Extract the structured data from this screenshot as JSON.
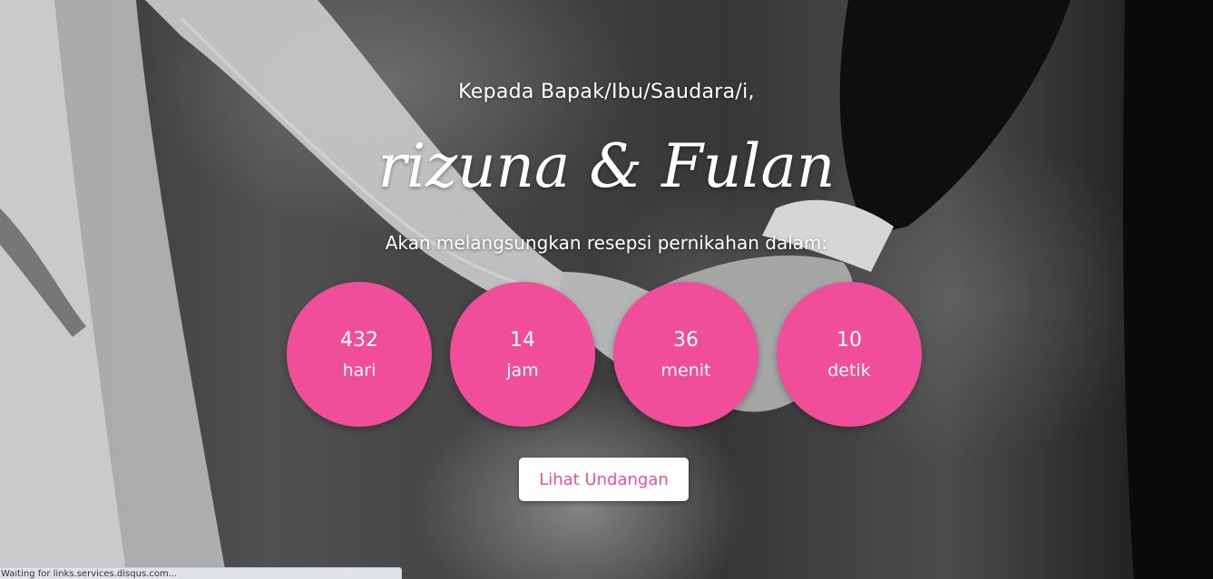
{
  "hero": {
    "greeting": "Kepada Bapak/Ibu/Saudara/i,",
    "couple_names": "rizuna & Fulan",
    "subtitle": "Akan melangsungkan resepsi pernikahan dalam:",
    "accent_color": "#f04e99"
  },
  "countdown": [
    {
      "value": "432",
      "unit": "hari"
    },
    {
      "value": "14",
      "unit": "jam"
    },
    {
      "value": "36",
      "unit": "menit"
    },
    {
      "value": "10",
      "unit": "detik"
    }
  ],
  "cta": {
    "label": "Lihat Undangan"
  },
  "status_bar": {
    "text": "Waiting for links.services.disqus.com..."
  }
}
